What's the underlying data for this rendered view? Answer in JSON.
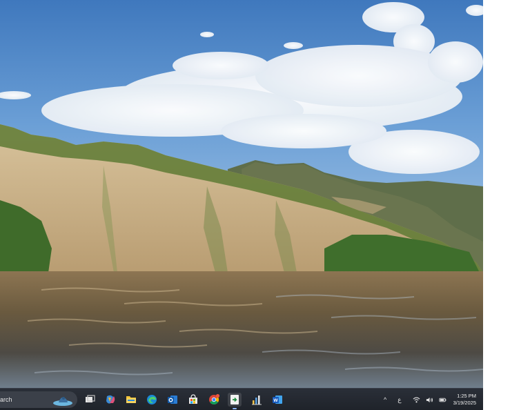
{
  "wallpaper": {
    "description_icon": "landscape-wallpaper",
    "colors": {
      "sky": "#4f86c6",
      "cloud": "#f4f6f9",
      "cliff": "#cdb38c",
      "vegetation": "#4a6b2a",
      "water": "#7a6646"
    }
  },
  "taskbar": {
    "search_placeholder": "arch",
    "apps": [
      {
        "name": "task-view",
        "icon": "task-view-icon"
      },
      {
        "name": "copilot",
        "icon": "copilot-icon"
      },
      {
        "name": "file-explorer",
        "icon": "folder-icon"
      },
      {
        "name": "edge",
        "icon": "edge-browser-icon"
      },
      {
        "name": "outlook",
        "icon": "outlook-icon"
      },
      {
        "name": "microsoft-store",
        "icon": "store-icon"
      },
      {
        "name": "chrome",
        "icon": "chrome-icon"
      },
      {
        "name": "active-app",
        "icon": "green-arrow-app-icon"
      },
      {
        "name": "chart-app",
        "icon": "chart-app-icon"
      },
      {
        "name": "word",
        "icon": "word-icon"
      }
    ],
    "tray": {
      "chevron": "^",
      "language": "ع",
      "time": "1:25 PM",
      "date": "3/19/2025"
    }
  }
}
